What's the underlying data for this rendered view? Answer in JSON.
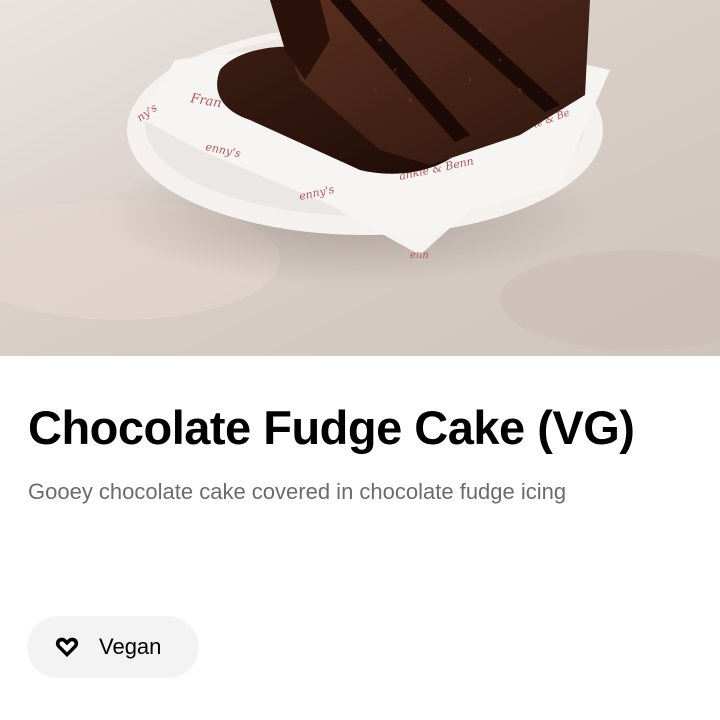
{
  "item": {
    "image_alt": "Slice of chocolate fudge cake on a white plate with branded paper",
    "paper_print_text": "Frankie & Benny's",
    "title": "Chocolate Fudge Cake (VG)",
    "description": "Gooey chocolate cake covered in chocolate fudge icing",
    "badge": {
      "icon": "heart-icon",
      "label": "Vegan"
    }
  },
  "colors": {
    "background": "#ffffff",
    "title": "#000000",
    "description": "#6b6b6b",
    "badge_background": "#f3f3f3"
  }
}
